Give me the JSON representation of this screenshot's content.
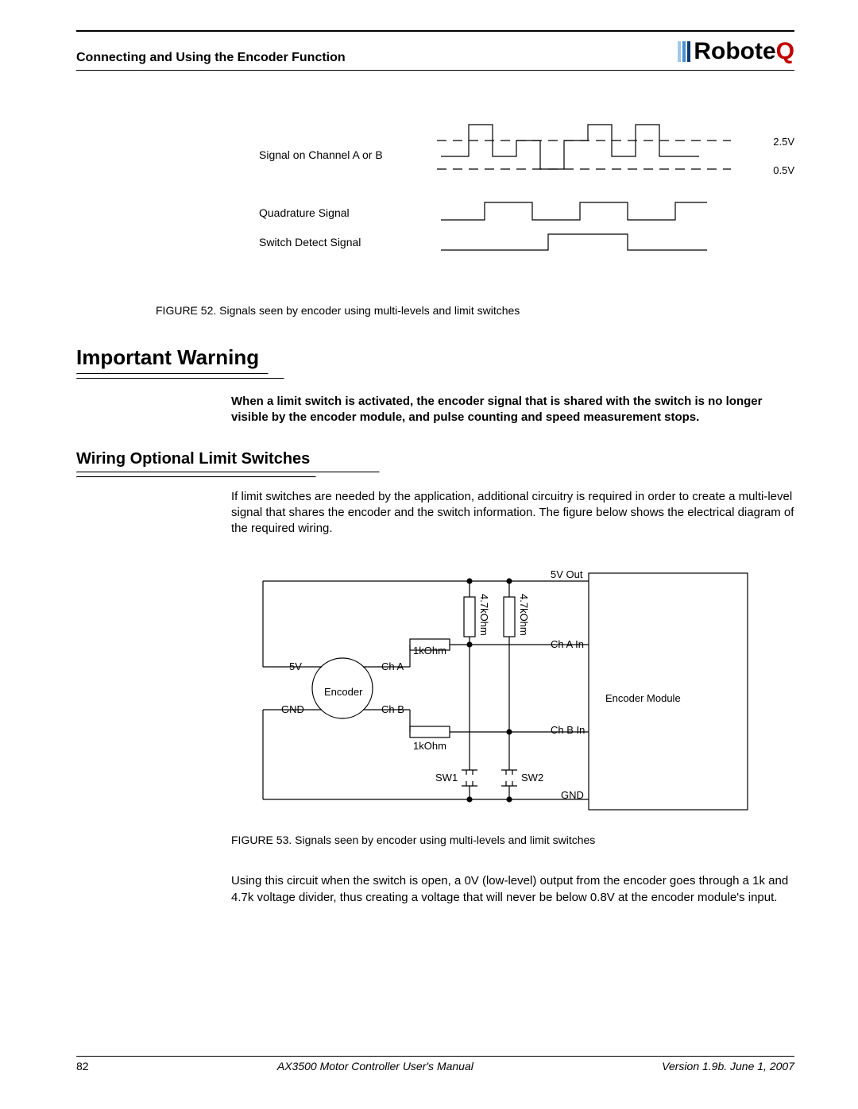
{
  "header": {
    "section": "Connecting and Using the Encoder Function",
    "logo_text_1": "Robote",
    "logo_text_2": "Q"
  },
  "fig52": {
    "label_signal": "Signal on Channel A or B",
    "label_quad": "Quadrature Signal",
    "label_switch": "Switch Detect Signal",
    "v_high": "2.5V",
    "v_low": "0.5V",
    "caption": "FIGURE 52. Signals seen by encoder using multi-levels and limit switches"
  },
  "warning": {
    "title": "Important Warning",
    "body": "When a limit switch is activated, the encoder signal that is shared with the switch is no longer visible by the encoder module, and pulse counting and speed measurement stops."
  },
  "wiring": {
    "title": "Wiring Optional Limit Switches",
    "p1": "If limit switches are needed by the application, additional circuitry is required in order to create a multi-level signal that shares the encoder and the switch information. The figure below shows the electrical diagram of the required wiring.",
    "p2": "Using this circuit when the switch is open, a 0V (low-level) output from the encoder goes through a 1k and 4.7k voltage divider, thus creating a voltage that will never be below 0.8V at the encoder module's input."
  },
  "fig53": {
    "labels": {
      "v5out": "5V Out",
      "r47a": "4.7kOhm",
      "r47b": "4.7kOhm",
      "r1a": "1kOhm",
      "r1b": "1kOhm",
      "chain": "Ch A In",
      "chbin": "Ch B In",
      "cha": "Ch A",
      "chb": "Ch B",
      "v5": "5V",
      "gnd": "GND",
      "gnd2": "GND",
      "encoder": "Encoder",
      "module": "Encoder Module",
      "sw1": "SW1",
      "sw2": "SW2"
    },
    "caption": "FIGURE 53. Signals seen by encoder using multi-levels and limit switches"
  },
  "footer": {
    "page": "82",
    "title": "AX3500 Motor Controller User's Manual",
    "version": "Version 1.9b. June 1, 2007"
  }
}
